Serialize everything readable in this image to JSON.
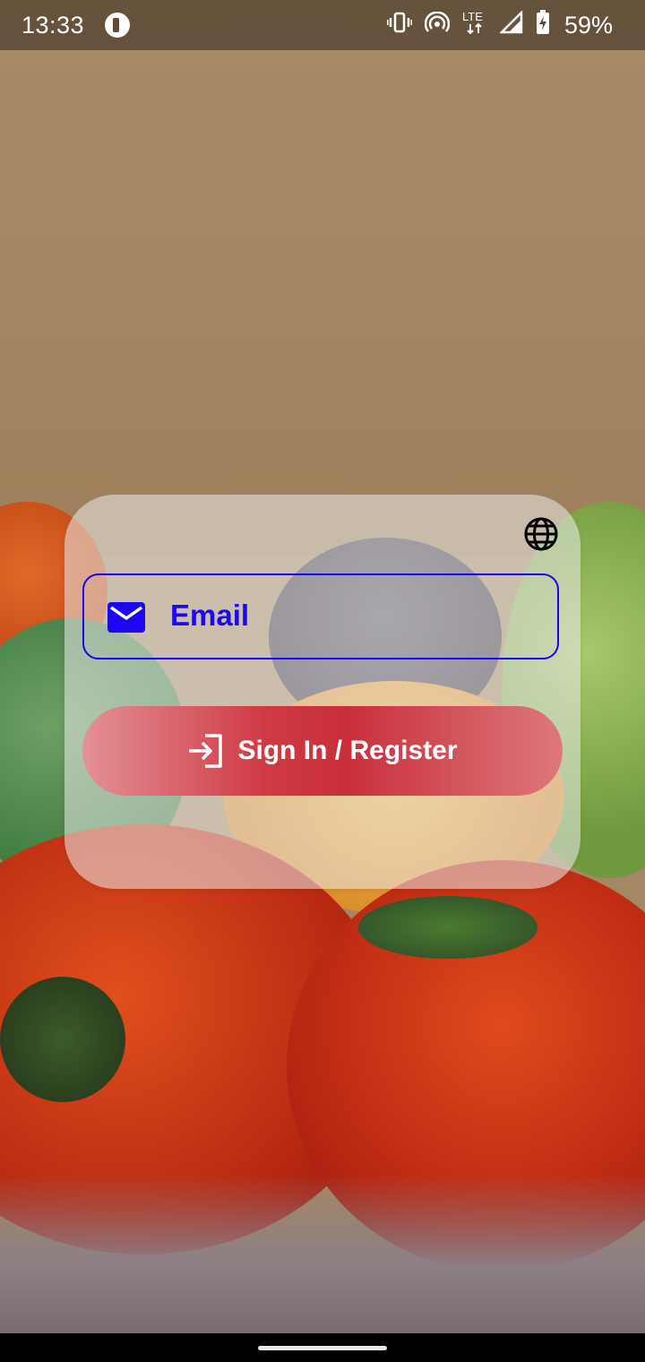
{
  "status_bar": {
    "time": "13:33",
    "battery_percent": "59%",
    "network_type": "LTE",
    "icons": [
      "app-notification-icon",
      "vibrate-icon",
      "hotspot-icon",
      "lte-icon",
      "signal-icon",
      "battery-charging-icon"
    ]
  },
  "login_card": {
    "language_icon": "globe-icon",
    "email_field": {
      "placeholder": "Email",
      "value": "",
      "icon": "mail-icon",
      "border_color": "#1900ff"
    },
    "signin_button": {
      "label": "Sign In / Register",
      "icon": "login-icon"
    }
  },
  "nav_bar": {
    "home_handle": "gesture-handle"
  }
}
